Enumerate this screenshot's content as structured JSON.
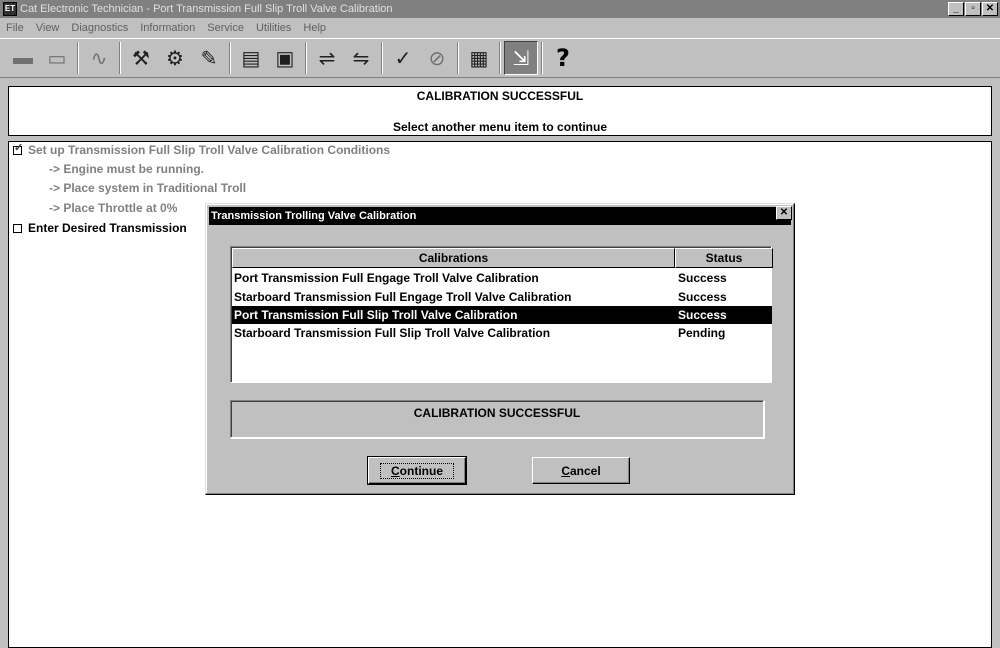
{
  "window": {
    "title": "Cat Electronic Technician - Port Transmission Full Slip Troll Valve Calibration",
    "icon": "cat-et-icon",
    "controls": [
      "_",
      "▫",
      "✕"
    ]
  },
  "menu": [
    "File",
    "View",
    "Diagnostics",
    "Information",
    "Service",
    "Utilities",
    "Help"
  ],
  "toolbar": {
    "help_label": "?"
  },
  "status_panel": {
    "line1": "CALIBRATION SUCCESSFUL",
    "line2": "Select another menu item to continue"
  },
  "steps": {
    "step1": "Set up Transmission Full Slip Troll Valve Calibration Conditions",
    "sub1": "-> Engine must be running.",
    "sub2": "-> Place system in Traditional Troll",
    "sub3": "-> Place Throttle at 0%",
    "step2": "Enter Desired Transmission"
  },
  "dialog": {
    "title": "Transmission Trolling Valve Calibration",
    "close": "✕",
    "columns": {
      "name": "Calibrations",
      "status": "Status"
    },
    "rows": [
      {
        "name": "Port Transmission Full Engage Troll Valve Calibration",
        "status": "Success"
      },
      {
        "name": "Starboard Transmission Full Engage Troll Valve Calibration",
        "status": "Success"
      },
      {
        "name": "Port Transmission Full Slip Troll Valve Calibration",
        "status": "Success"
      },
      {
        "name": "Starboard Transmission Full Slip Troll Valve Calibration",
        "status": "Pending"
      }
    ],
    "message": "CALIBRATION SUCCESSFUL",
    "continue_first": "C",
    "continue_rest": "ontinue",
    "cancel_first": "C",
    "cancel_rest": "ancel"
  }
}
